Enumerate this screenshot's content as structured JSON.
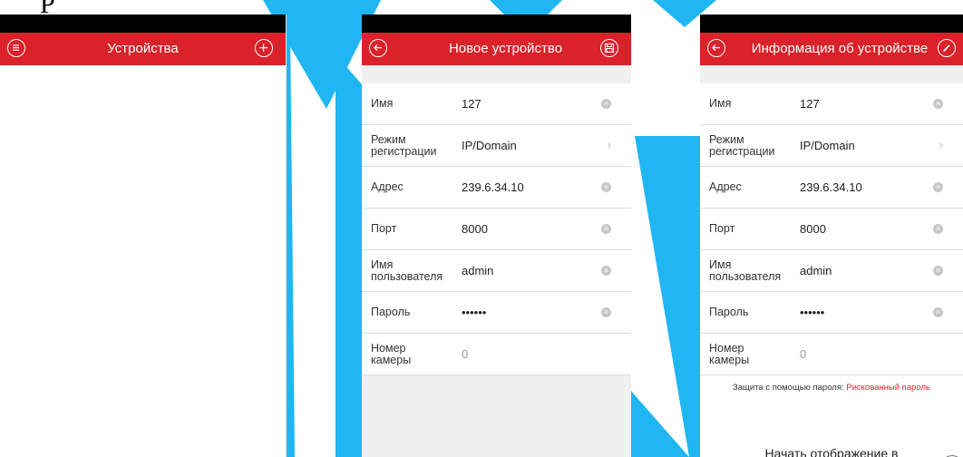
{
  "colors": {
    "accent": "#d9222a",
    "risk": "#e0262d",
    "watermark": "#1fb6f2"
  },
  "top_fragment": "P",
  "screen1": {
    "title": "Устройства",
    "left_icon": "menu-icon",
    "right_icon": "add-icon"
  },
  "screen2": {
    "title": "Новое устройство",
    "left_icon": "back-icon",
    "right_icon": "save-icon",
    "rows": [
      {
        "label": "Имя",
        "value": "127",
        "action": "clear"
      },
      {
        "label": "Режим регистрации",
        "value": "IP/Domain",
        "action": "chevron"
      },
      {
        "label": "Адрес",
        "value": "239.6.34.10",
        "action": "clear"
      },
      {
        "label": "Порт",
        "value": "8000",
        "action": "clear"
      },
      {
        "label": "Имя пользователя",
        "value": "admin",
        "action": "clear"
      },
      {
        "label": "Пароль",
        "value": "••••••",
        "action": "clear"
      },
      {
        "label": "Номер камеры",
        "value": "0",
        "action": "none"
      }
    ]
  },
  "screen3": {
    "title": "Информация об устройстве",
    "left_icon": "back-icon",
    "right_icon": "edit-icon",
    "rows": [
      {
        "label": "Имя",
        "value": "127",
        "action": "clear"
      },
      {
        "label": "Режим регистрации",
        "value": "IP/Domain",
        "action": "chevron"
      },
      {
        "label": "Адрес",
        "value": "239.6.34.10",
        "action": "clear"
      },
      {
        "label": "Порт",
        "value": "8000",
        "action": "clear"
      },
      {
        "label": "Имя пользователя",
        "value": "admin",
        "action": "clear"
      },
      {
        "label": "Пароль",
        "value": "••••••",
        "action": "clear"
      },
      {
        "label": "Номер камеры",
        "value": "0",
        "action": "none"
      }
    ],
    "password_protection_label": "Защита с помощью пароля:",
    "password_protection_value": "Рискованный пароль",
    "live_view_button": "Начать отображение в реальном времени",
    "more_icon": "more-icon"
  }
}
